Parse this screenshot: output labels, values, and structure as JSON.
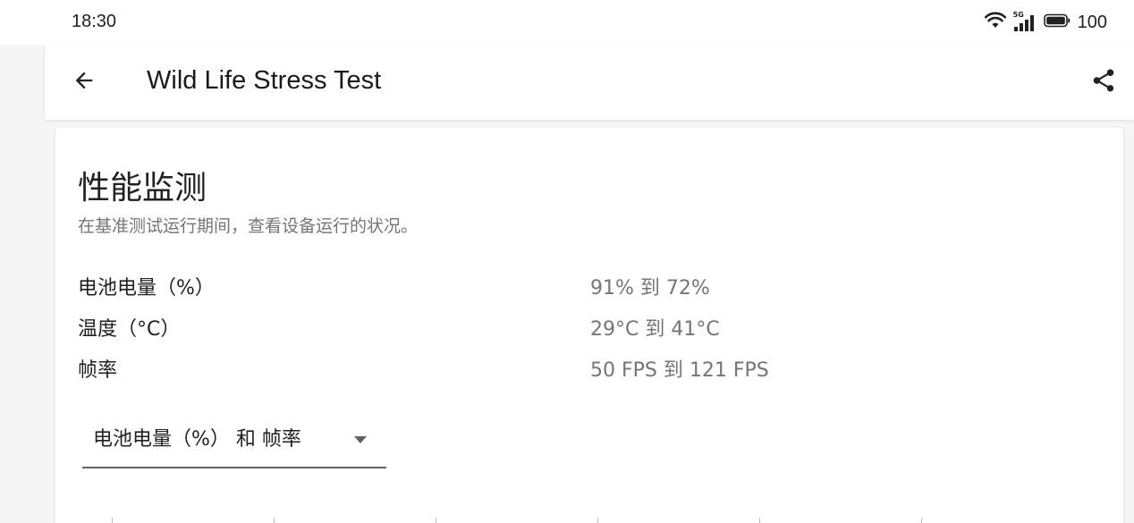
{
  "status_bar": {
    "time": "18:30",
    "battery": "100",
    "network": "5G"
  },
  "app_bar": {
    "title": "Wild Life Stress Test"
  },
  "card": {
    "title": "性能监测",
    "subtitle": "在基准测试运行期间，查看设备运行的状况。",
    "metrics": [
      {
        "label": "电池电量（%）",
        "value": "91% 到 72%"
      },
      {
        "label": "温度（°C）",
        "value": "29°C 到 41°C"
      },
      {
        "label": "帧率",
        "value": "50 FPS 到 121 FPS"
      }
    ],
    "dropdown": {
      "selected": "电池电量（%） 和 帧率"
    }
  },
  "colors": {
    "text_primary": "#212121",
    "text_secondary": "#757575",
    "surface": "#ffffff",
    "background": "#f5f5f5"
  },
  "icons": {
    "back": "arrow-left-icon",
    "share": "share-icon",
    "wifi": "wifi-icon",
    "signal": "signal-icon",
    "battery": "battery-icon",
    "dropdown": "triangle-down-icon"
  }
}
